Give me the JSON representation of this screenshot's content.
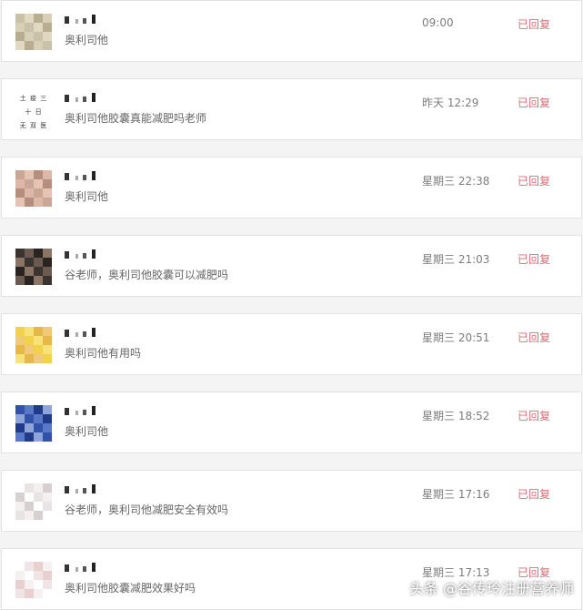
{
  "messages": [
    {
      "message": "奥利司他",
      "time": "09:00",
      "status": "已回复",
      "avatar_colors": [
        "#c9c2a8",
        "#e0d8c0",
        "#b8ad90",
        "#d8d0b6"
      ]
    },
    {
      "message": "奥利司他胶囊真能减肥吗老师",
      "time": "昨天 12:29",
      "status": "已回复",
      "avatar_text": [
        "土 疫 三 十 日",
        "无 双 医 生"
      ]
    },
    {
      "message": "奥利司他",
      "time": "星期三 22:38",
      "status": "已回复",
      "avatar_colors": [
        "#caa696",
        "#e5c4b4",
        "#b58e7e",
        "#ddb8a8"
      ]
    },
    {
      "message": "谷老师，奥利司他胶囊可以减肥吗",
      "time": "星期三 21:03",
      "status": "已回复",
      "avatar_colors": [
        "#3a3330",
        "#6b5a50",
        "#2a2420",
        "#8a7565"
      ]
    },
    {
      "message": "奥利司他有用吗",
      "time": "星期三 20:51",
      "status": "已回复",
      "avatar_colors": [
        "#f2d24a",
        "#f7e27a",
        "#e6b84a",
        "#f0c97a"
      ]
    },
    {
      "message": "奥利司他",
      "time": "星期三 18:52",
      "status": "已回复",
      "avatar_colors": [
        "#3152a8",
        "#5a78c8",
        "#223b88",
        "#8fa4d8"
      ]
    },
    {
      "message": "谷老师，奥利司他减肥安全有效吗",
      "time": "星期三 17:16",
      "status": "已回复",
      "avatar_colors": [
        "#ffffff",
        "#e8e4e4",
        "#f4f0f0",
        "#d8d0d0"
      ]
    },
    {
      "message": "奥利司他胶囊减肥效果好吗",
      "time": "星期三 17:13",
      "status": "已回复",
      "avatar_colors": [
        "#ffffff",
        "#f0e4e4",
        "#e8d0d0",
        "#f6f0f0"
      ]
    }
  ],
  "watermark": "头条 @谷传玲注册营养师"
}
